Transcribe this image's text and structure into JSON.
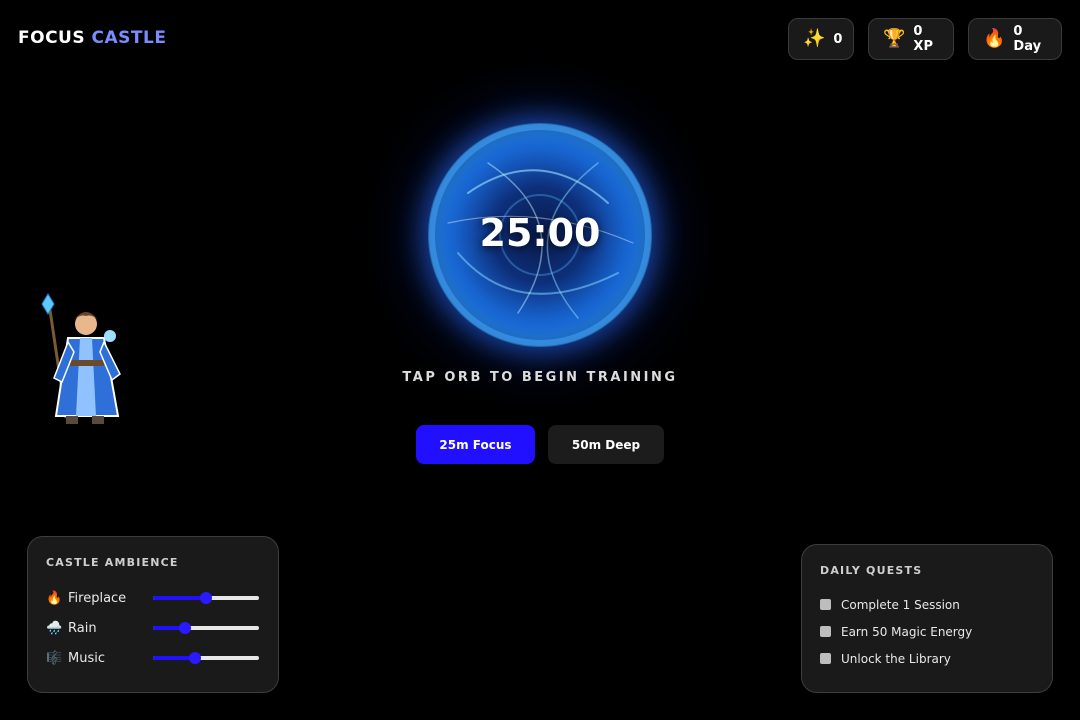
{
  "brand": {
    "word1": "FOCUS",
    "word2": "CASTLE",
    "accent_color": "#7b8cff"
  },
  "stats": [
    {
      "icon": "sparkles-icon",
      "glyph": "✨",
      "value": "0"
    },
    {
      "icon": "trophy-icon",
      "glyph": "🏆",
      "value": "0 XP"
    },
    {
      "icon": "fire-icon",
      "glyph": "🔥",
      "value": "0 Day"
    }
  ],
  "orb": {
    "timer": "25:00"
  },
  "hint": "TAP ORB TO BEGIN TRAINING",
  "modes": {
    "focus_label": "25m Focus",
    "deep_label": "50m Deep",
    "active_color": "#2010ff"
  },
  "ambience": {
    "title": "CASTLE AMBIENCE",
    "items": [
      {
        "icon": "fire-icon",
        "glyph": "🔥",
        "label": "Fireplace",
        "level": 0.5
      },
      {
        "icon": "rain-cloud-icon",
        "glyph": "🌧️",
        "label": "Rain",
        "level": 0.3
      },
      {
        "icon": "music-notes-icon",
        "glyph": "🎼",
        "label": "Music",
        "level": 0.4
      }
    ]
  },
  "quests": {
    "title": "DAILY QUESTS",
    "items": [
      {
        "label": "Complete 1 Session",
        "done": false
      },
      {
        "label": "Earn 50 Magic Energy",
        "done": false
      },
      {
        "label": "Unlock the Library",
        "done": false
      }
    ]
  }
}
